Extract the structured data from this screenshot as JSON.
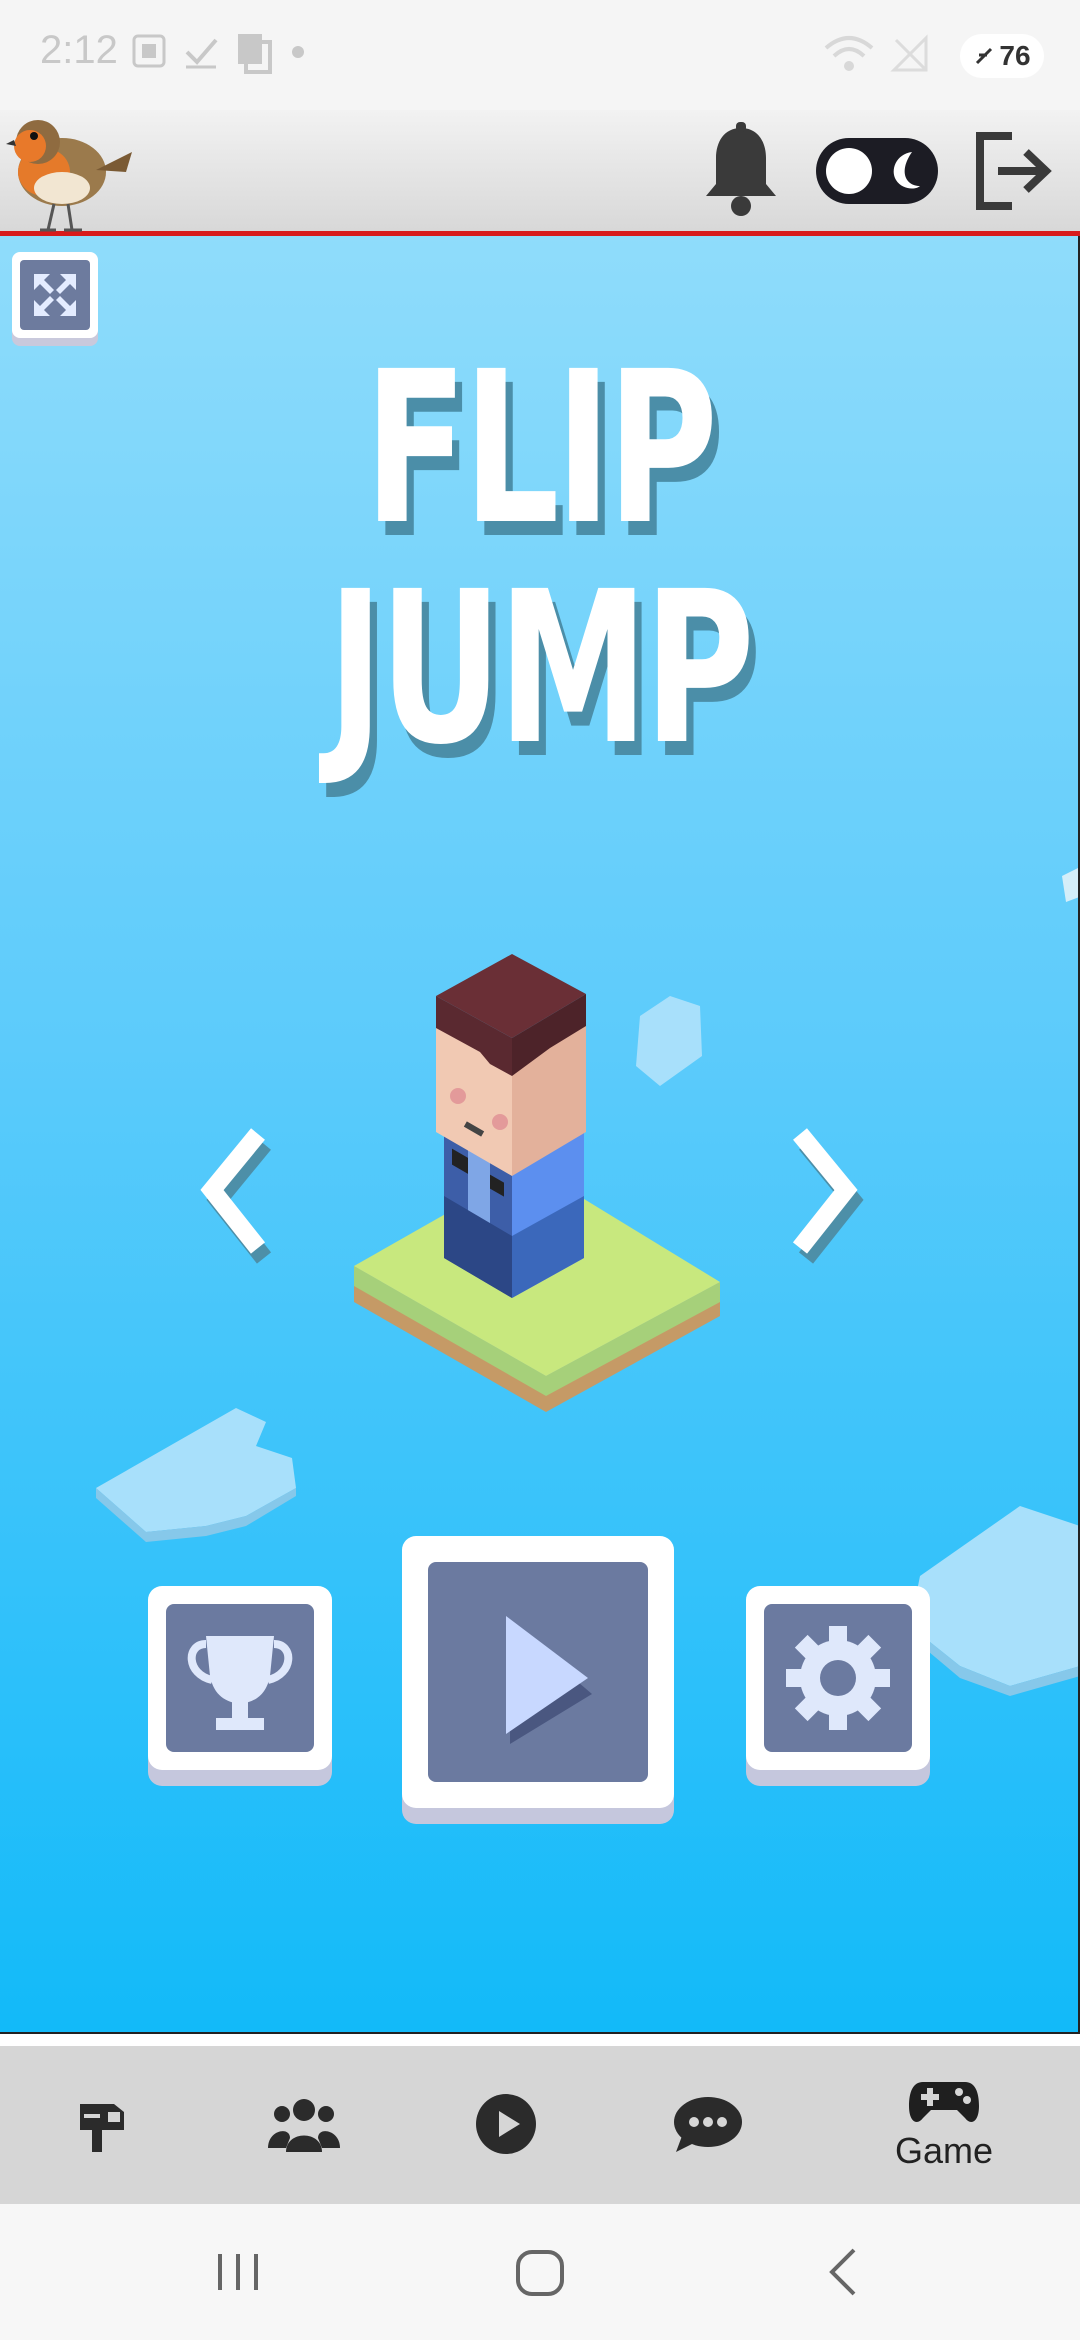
{
  "status_bar": {
    "time": "2:12",
    "battery": "76",
    "icons": [
      "screenshot-icon",
      "check-icon",
      "copy-icon",
      "dot-icon",
      "wifi-icon",
      "no-signal-icon",
      "battery-icon"
    ]
  },
  "header": {
    "logo": "robin-bird-logo",
    "icons": [
      "bell-icon",
      "dark-mode-toggle",
      "logout-icon"
    ]
  },
  "game": {
    "title_line1": "FLIP",
    "title_line2": "JUMP",
    "buttons": [
      "fullscreen-button",
      "prev-character-button",
      "next-character-button",
      "leaderboard-button",
      "play-button",
      "settings-button"
    ]
  },
  "bottom_nav": {
    "items": [
      {
        "icon": "mailbox-icon",
        "label": ""
      },
      {
        "icon": "users-icon",
        "label": ""
      },
      {
        "icon": "play-circle-icon",
        "label": ""
      },
      {
        "icon": "chat-icon",
        "label": ""
      },
      {
        "icon": "gamepad-icon",
        "label": "Game"
      }
    ],
    "active": "Game"
  },
  "colors": {
    "sky_top": "#8fdcfb",
    "sky_bottom": "#12baf9",
    "button_face": "#6b7aa0",
    "header_border": "#d81b1b"
  }
}
